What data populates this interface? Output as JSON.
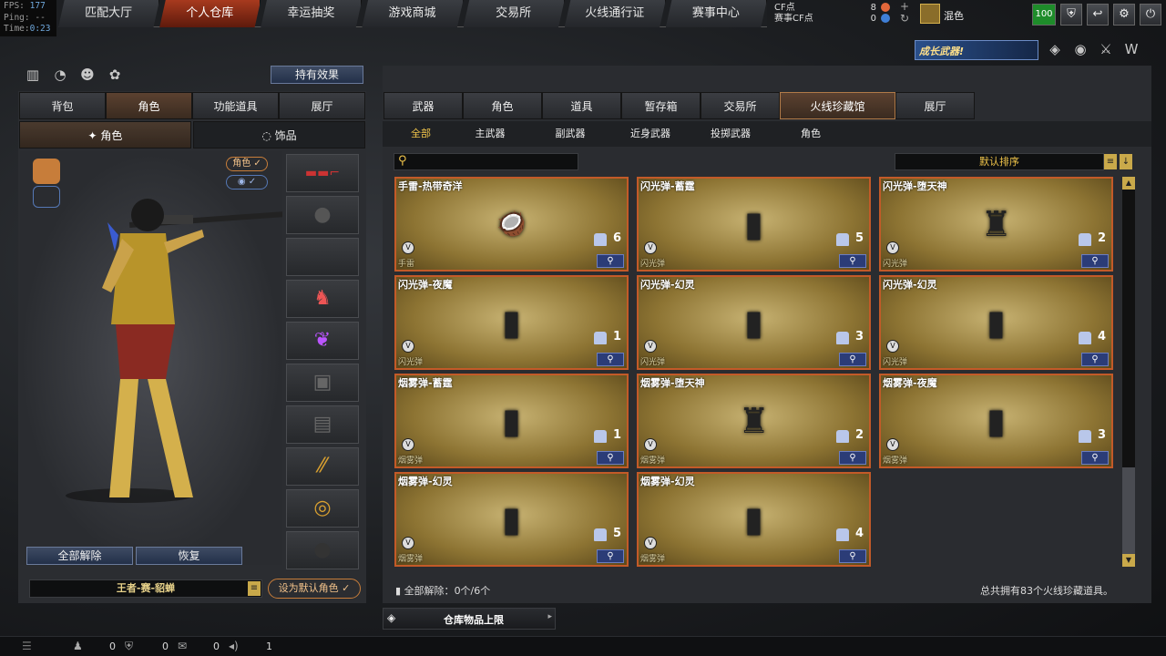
{
  "perf": {
    "fps_label": "FPS:",
    "fps": "177",
    "ping_label": "Ping:",
    "ping": "--",
    "time_label": "Time:",
    "time": "0:23"
  },
  "nav": [
    "匹配大厅",
    "个人仓库",
    "幸运抽奖",
    "游戏商城",
    "交易所",
    "火线通行证",
    "赛事中心"
  ],
  "currency": {
    "cf_label": "CF点",
    "cf_value": "8",
    "match_label": "赛事CF点",
    "match_value": "0"
  },
  "user": {
    "name": "混色",
    "level": "100"
  },
  "promo_text": "成长武器!",
  "owned_effects": "持有效果",
  "left_tabs": [
    "背包",
    "角色",
    "功能道具",
    "展厅"
  ],
  "sub_tabs": [
    "角色",
    "饰品"
  ],
  "role_toggle": "角色 ✓",
  "eye_toggle": "✓",
  "unequip_all": "全部解除",
  "restore": "恢复",
  "char_name": "王者-赛-貂蝉",
  "set_default": "设为默认角色 ✓",
  "right_tabs": [
    "武器",
    "角色",
    "道具",
    "暂存箱",
    "交易所",
    "火线珍藏馆",
    "展厅"
  ],
  "filters": [
    "全部",
    "主武器",
    "副武器",
    "近身武器",
    "投掷武器",
    "角色"
  ],
  "sort_label": "默认排序",
  "items": [
    {
      "name": "手雷-热带奇洋",
      "tag": "手雷",
      "count": "6",
      "art": "🥥"
    },
    {
      "name": "闪光弹-蓄霆",
      "tag": "闪光弹",
      "count": "5",
      "art": "▮"
    },
    {
      "name": "闪光弹-堕天神",
      "tag": "闪光弹",
      "count": "2",
      "art": "♜"
    },
    {
      "name": "闪光弹-夜魔",
      "tag": "闪光弹",
      "count": "1",
      "art": "▮"
    },
    {
      "name": "闪光弹-幻灵",
      "tag": "闪光弹",
      "count": "3",
      "art": "▮"
    },
    {
      "name": "闪光弹-幻灵",
      "tag": "闪光弹",
      "count": "4",
      "art": "▮"
    },
    {
      "name": "烟雾弹-蓄霆",
      "tag": "烟雾弹",
      "count": "1",
      "art": "▮"
    },
    {
      "name": "烟雾弹-堕天神",
      "tag": "烟雾弹",
      "count": "2",
      "art": "♜"
    },
    {
      "name": "烟雾弹-夜魔",
      "tag": "烟雾弹",
      "count": "3",
      "art": "▮"
    },
    {
      "name": "烟雾弹-幻灵",
      "tag": "烟雾弹",
      "count": "5",
      "art": "▮"
    },
    {
      "name": "烟雾弹-幻灵",
      "tag": "烟雾弹",
      "count": "4",
      "art": "▮"
    }
  ],
  "bottom": {
    "unequip": "全部解除：",
    "unequip_count": "0个/6个",
    "total": "总共拥有83个火线珍藏道具。",
    "storage": "仓库物品上限"
  },
  "status": {
    "a": "0",
    "b": "0",
    "c": "0",
    "d": "1"
  }
}
